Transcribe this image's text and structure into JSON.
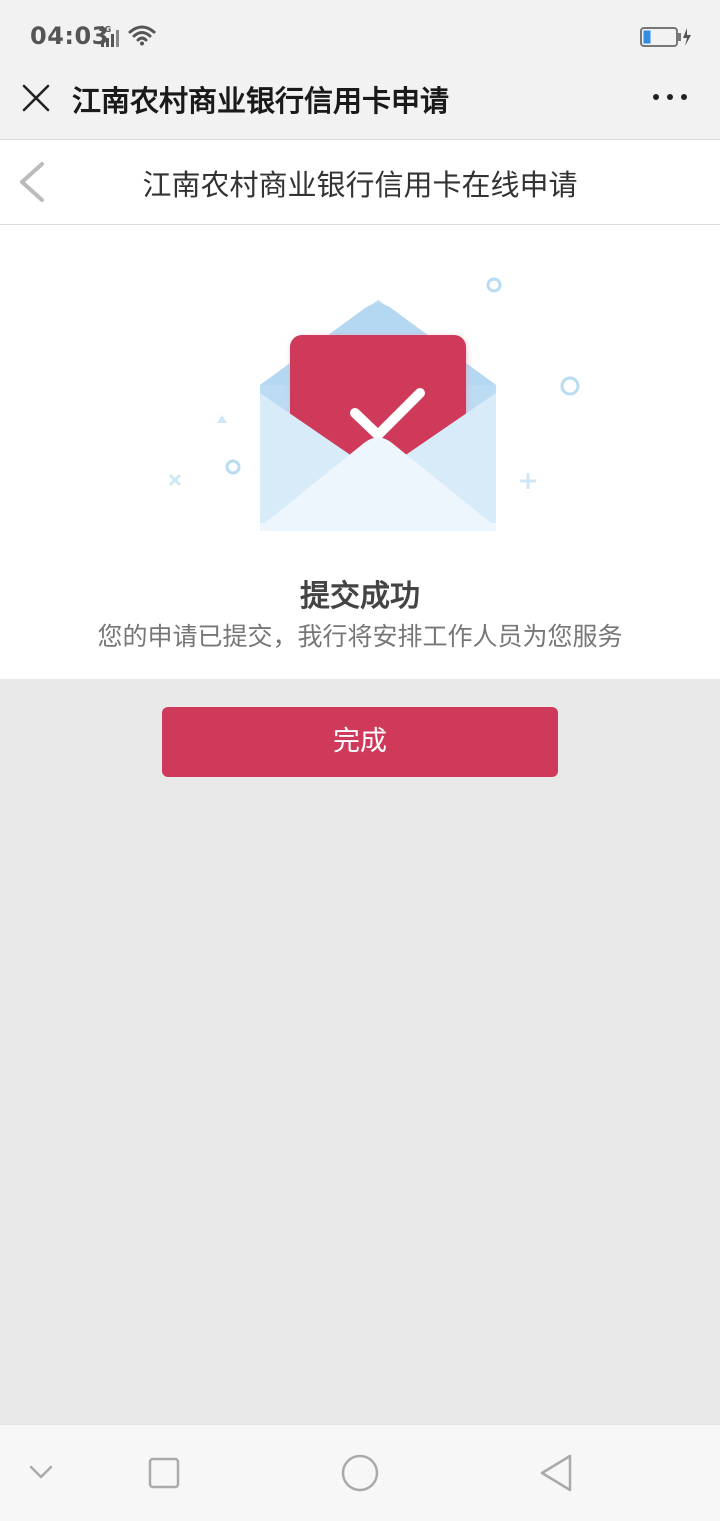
{
  "status_bar": {
    "time": "04:03",
    "network": "4G"
  },
  "header": {
    "title": "江南农村商业银行信用卡申请"
  },
  "page": {
    "title": "江南农村商业银行信用卡在线申请"
  },
  "result": {
    "title": "提交成功",
    "description": "您的申请已提交，我行将安排工作人员为您服务"
  },
  "actions": {
    "done_label": "完成"
  },
  "colors": {
    "accent": "#cf3a5a",
    "envelope": "#cfe6f7",
    "battery": "#2f8de4"
  },
  "icons": {
    "close": "close-icon",
    "more": "more-icon",
    "back": "back-icon",
    "success": "envelope-check-icon",
    "nav_down": "chevron-down-icon",
    "nav_recent": "square-icon",
    "nav_home": "circle-icon",
    "nav_back": "triangle-back-icon"
  }
}
